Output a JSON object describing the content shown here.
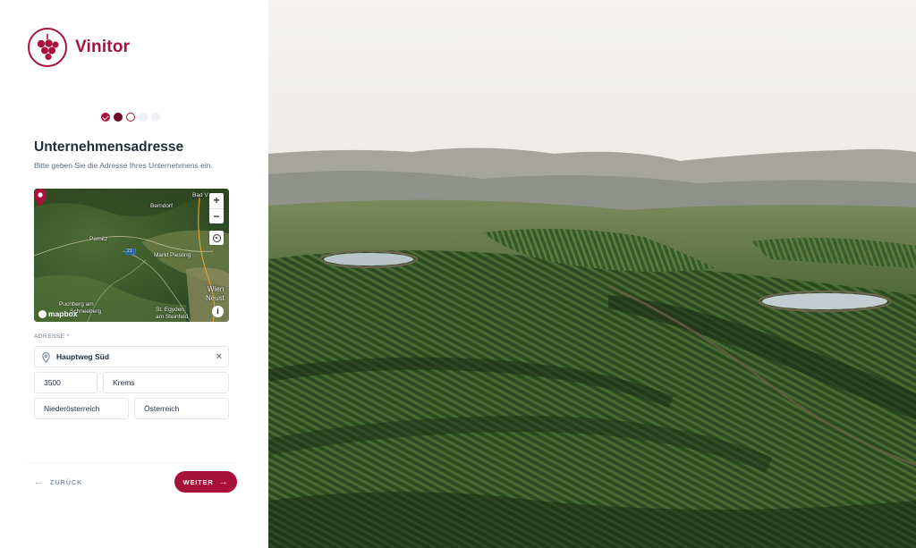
{
  "brand": {
    "name": "Vinitor",
    "icon": "grape-logo-icon",
    "color": "#a8123a"
  },
  "stepper": {
    "steps": [
      "done",
      "active",
      "current",
      "todo",
      "todo"
    ]
  },
  "form": {
    "title": "Unternehmensadresse",
    "subtitle": "Bitte geben Sie die Adresse Ihres Unternehmens ein.",
    "address_label": "ADRESSE *",
    "street": "Hauptweg Süd",
    "zip": "3500",
    "city": "Krems",
    "state": "Niederösterreich",
    "country": "Österreich"
  },
  "map": {
    "labels": {
      "berndorf": "Berndorf",
      "pernitz": "Pernitz",
      "badv": "Bad V",
      "markt": "Markt Piesting",
      "route": "21",
      "wien": "Wien",
      "neust": "Neust",
      "puchberg1": "Puchberg am",
      "puchberg2": "Schneeberg",
      "egyden1": "St. Egyden",
      "egyden2": "am Steinfeld"
    },
    "zoom_in": "+",
    "zoom_out": "−",
    "attribution": "mapbox",
    "info": "i"
  },
  "nav": {
    "back_label": "ZURÜCK",
    "next_label": "WEITER",
    "back_icon": "arrow-left-icon",
    "next_icon": "arrow-right-icon"
  },
  "background": {
    "image": "vineyard-aerial-photo"
  }
}
